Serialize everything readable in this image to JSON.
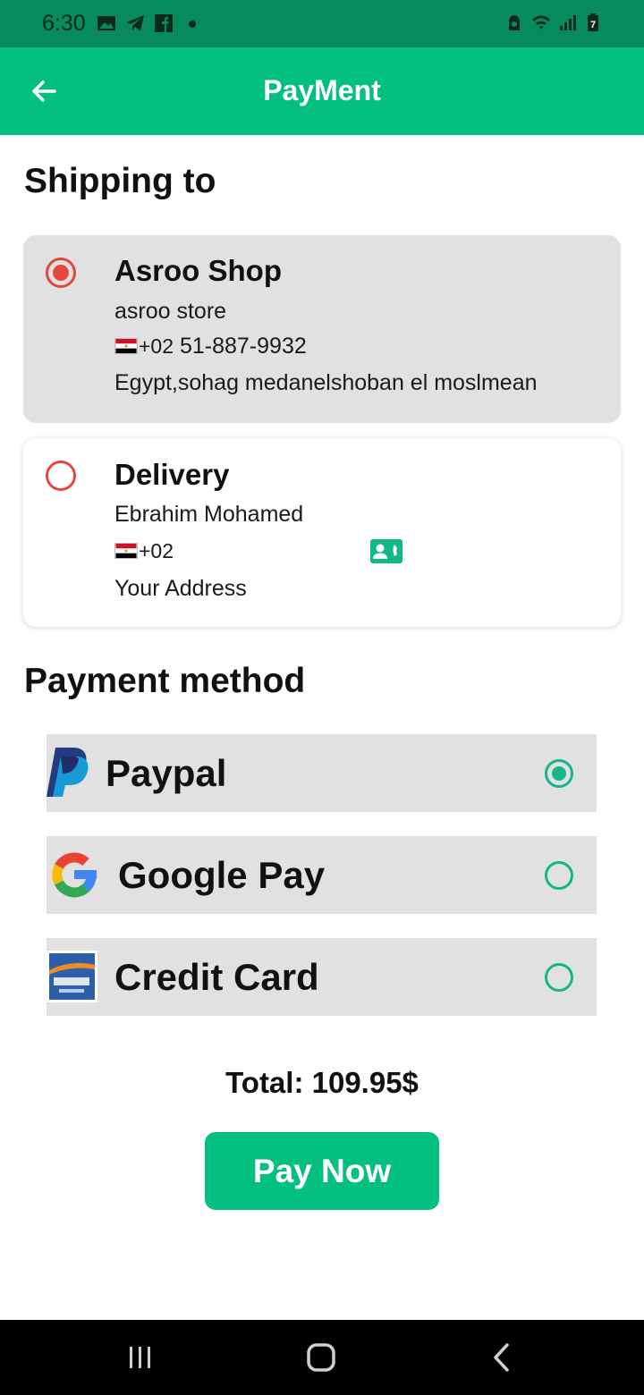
{
  "status_bar": {
    "time": "6:30",
    "left_icons": [
      "gallery-icon",
      "telegram-icon",
      "facebook-icon",
      "dot-icon"
    ],
    "right_icons": [
      "alarm-icon",
      "wifi-icon",
      "signal-icon",
      "battery-icon"
    ],
    "battery_level": "7"
  },
  "app_bar": {
    "title": "PayMent",
    "back_icon": "arrow-left-icon"
  },
  "shipping": {
    "title": "Shipping to",
    "addresses": [
      {
        "name": "Asroo Shop",
        "subtitle": "asroo store",
        "phone_code": "+02",
        "phone": " 51-887-9932",
        "address": "Egypt,sohag medanelshoban el moslmean",
        "selected": true
      },
      {
        "name": "Delivery",
        "subtitle": "Ebrahim Mohamed",
        "phone_code": "+02",
        "phone": "",
        "address": "Your Address",
        "selected": false
      }
    ]
  },
  "payment": {
    "title": "Payment method",
    "methods": [
      {
        "label": "Paypal",
        "icon": "paypal-icon",
        "selected": true
      },
      {
        "label": "Google Pay",
        "icon": "google-icon",
        "selected": false
      },
      {
        "label": "Credit Card",
        "icon": "credit-card-icon",
        "selected": false
      }
    ]
  },
  "total": {
    "text": "Total: 109.95$"
  },
  "pay_button": {
    "label": "Pay Now"
  },
  "colors": {
    "primary": "#03BF82",
    "status_bar": "#078A5E",
    "radio_red": "#E2483D",
    "radio_green": "#12B886",
    "card_gray": "#E1E1E1"
  }
}
